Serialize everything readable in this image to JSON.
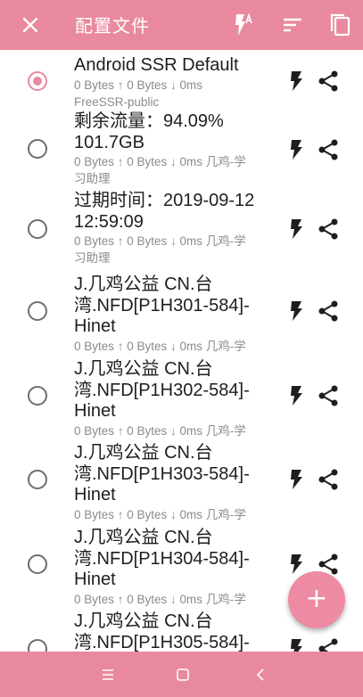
{
  "appbar": {
    "title": "配置文件",
    "close_icon": "close-icon",
    "actions": [
      "flash-auto-icon",
      "sort-icon",
      "copy-icon"
    ]
  },
  "profiles": [
    {
      "name": "Android SSR Default",
      "stats": "0 Bytes ↑ 0 Bytes ↓ 0ms\nFreeSSR-public",
      "selected": true
    },
    {
      "name": "剩余流量：94.09%\n101.7GB",
      "stats": "0 Bytes ↑ 0 Bytes ↓ 0ms 几鸡-学\n习助理",
      "selected": false
    },
    {
      "name": "过期时间：2019-09-12\n12:59:09",
      "stats": "0 Bytes ↑ 0 Bytes ↓ 0ms 几鸡-学\n习助理",
      "selected": false
    },
    {
      "name": "J.几鸡公益 CN.台\n湾.NFD[P1H301-584]-\nHinet",
      "stats": "0 Bytes ↑ 0 Bytes ↓ 0ms 几鸡-学",
      "selected": false
    },
    {
      "name": "J.几鸡公益 CN.台\n湾.NFD[P1H302-584]-\nHinet",
      "stats": "0 Bytes ↑ 0 Bytes ↓ 0ms 几鸡-学",
      "selected": false
    },
    {
      "name": "J.几鸡公益 CN.台\n湾.NFD[P1H303-584]-\nHinet",
      "stats": "0 Bytes ↑ 0 Bytes ↓ 0ms 几鸡-学",
      "selected": false
    },
    {
      "name": "J.几鸡公益 CN.台\n湾.NFD[P1H304-584]-\nHinet",
      "stats": "0 Bytes ↑ 0 Bytes ↓ 0ms 几鸡-学",
      "selected": false
    },
    {
      "name": "J.几鸡公益 CN.台\n湾.NFD[P1H305-584]-",
      "stats": "",
      "selected": false
    }
  ],
  "fab": {
    "label": "+"
  },
  "colors": {
    "accent": "#e9899f",
    "text": "#1e1e1e",
    "secondary": "#8b8b8b"
  },
  "navbar": {
    "icons": [
      "menu-icon",
      "home-icon",
      "back-icon"
    ]
  }
}
